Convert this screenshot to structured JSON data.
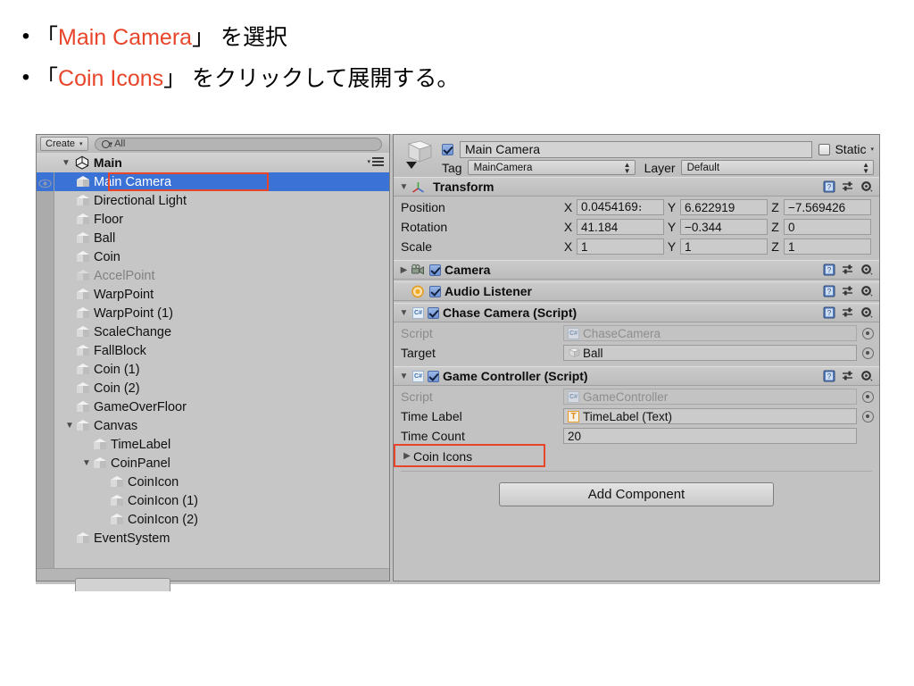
{
  "slide": {
    "bullets": [
      {
        "marker": "•",
        "pre": "「",
        "highlight": "Main Camera",
        "post": "」 を選択"
      },
      {
        "marker": "•",
        "pre": "「",
        "highlight": "Coin Icons",
        "post": "」 をクリックして展開する。"
      }
    ],
    "highlight_color": "#e8452b"
  },
  "hierarchy": {
    "toolbar": {
      "create_label": "Create",
      "create_caret": "▾",
      "search_prefix": "Q",
      "search_caret": "▾",
      "search_value": "All"
    },
    "scene": {
      "fold": "▼",
      "name": "Main",
      "menu_caret": "▾"
    },
    "items": [
      {
        "label": "Main Camera",
        "indent": 1,
        "fold": "",
        "selected": true,
        "disabled": false,
        "eye": true
      },
      {
        "label": "Directional Light",
        "indent": 1,
        "fold": "",
        "selected": false,
        "disabled": false,
        "eye": false
      },
      {
        "label": "Floor",
        "indent": 1,
        "fold": "",
        "selected": false,
        "disabled": false,
        "eye": false
      },
      {
        "label": "Ball",
        "indent": 1,
        "fold": "",
        "selected": false,
        "disabled": false,
        "eye": false
      },
      {
        "label": "Coin",
        "indent": 1,
        "fold": "",
        "selected": false,
        "disabled": false,
        "eye": false
      },
      {
        "label": "AccelPoint",
        "indent": 1,
        "fold": "",
        "selected": false,
        "disabled": true,
        "eye": false
      },
      {
        "label": "WarpPoint",
        "indent": 1,
        "fold": "",
        "selected": false,
        "disabled": false,
        "eye": false
      },
      {
        "label": "WarpPoint (1)",
        "indent": 1,
        "fold": "",
        "selected": false,
        "disabled": false,
        "eye": false
      },
      {
        "label": "ScaleChange",
        "indent": 1,
        "fold": "",
        "selected": false,
        "disabled": false,
        "eye": false
      },
      {
        "label": "FallBlock",
        "indent": 1,
        "fold": "",
        "selected": false,
        "disabled": false,
        "eye": false
      },
      {
        "label": "Coin (1)",
        "indent": 1,
        "fold": "",
        "selected": false,
        "disabled": false,
        "eye": false
      },
      {
        "label": "Coin (2)",
        "indent": 1,
        "fold": "",
        "selected": false,
        "disabled": false,
        "eye": false
      },
      {
        "label": "GameOverFloor",
        "indent": 1,
        "fold": "",
        "selected": false,
        "disabled": false,
        "eye": false
      },
      {
        "label": "Canvas",
        "indent": 1,
        "fold": "▼",
        "selected": false,
        "disabled": false,
        "eye": false
      },
      {
        "label": "TimeLabel",
        "indent": 2,
        "fold": "",
        "selected": false,
        "disabled": false,
        "eye": false
      },
      {
        "label": "CoinPanel",
        "indent": 2,
        "fold": "▼",
        "selected": false,
        "disabled": false,
        "eye": false
      },
      {
        "label": "CoinIcon",
        "indent": 3,
        "fold": "",
        "selected": false,
        "disabled": false,
        "eye": false
      },
      {
        "label": "CoinIcon (1)",
        "indent": 3,
        "fold": "",
        "selected": false,
        "disabled": false,
        "eye": false
      },
      {
        "label": "CoinIcon (2)",
        "indent": 3,
        "fold": "",
        "selected": false,
        "disabled": false,
        "eye": false
      },
      {
        "label": "EventSystem",
        "indent": 1,
        "fold": "",
        "selected": false,
        "disabled": false,
        "eye": false
      }
    ]
  },
  "inspector": {
    "game_object": {
      "enabled": true,
      "name": "Main Camera",
      "static_label": "Static",
      "static_checked": false,
      "static_caret": "▾",
      "tag_label": "Tag",
      "tag_value": "MainCamera",
      "layer_label": "Layer",
      "layer_value": "Default",
      "dd_arrows": "↕"
    },
    "transform": {
      "fold": "▼",
      "title": "Transform",
      "rows": [
        {
          "label": "Position",
          "x": "0.0454169։",
          "y": "6.622919",
          "z": "−7.569426"
        },
        {
          "label": "Rotation",
          "x": "41.184",
          "y": "−0.344",
          "z": "0"
        },
        {
          "label": "Scale",
          "x": "1",
          "y": "1",
          "z": "1"
        }
      ],
      "axis_labels": [
        "X",
        "Y",
        "Z"
      ]
    },
    "camera": {
      "fold": "▶",
      "title": "Camera",
      "enabled": true
    },
    "audio_listener": {
      "fold": "",
      "title": "Audio Listener",
      "enabled": true
    },
    "chase_camera": {
      "fold": "▼",
      "title": "Chase Camera (Script)",
      "enabled": true,
      "script_label": "Script",
      "script_value": "ChaseCamera",
      "target_label": "Target",
      "target_value": "Ball"
    },
    "game_controller": {
      "fold": "▼",
      "title": "Game Controller (Script)",
      "enabled": true,
      "script_label": "Script",
      "script_value": "GameController",
      "time_label_label": "Time Label",
      "time_label_value": "TimeLabel (Text)",
      "time_label_badge": "T",
      "time_count_label": "Time Count",
      "time_count_value": "20",
      "coin_icons_fold": "▶",
      "coin_icons_label": "Coin Icons"
    },
    "add_component_label": "Add Component",
    "script_badge": "C#"
  }
}
